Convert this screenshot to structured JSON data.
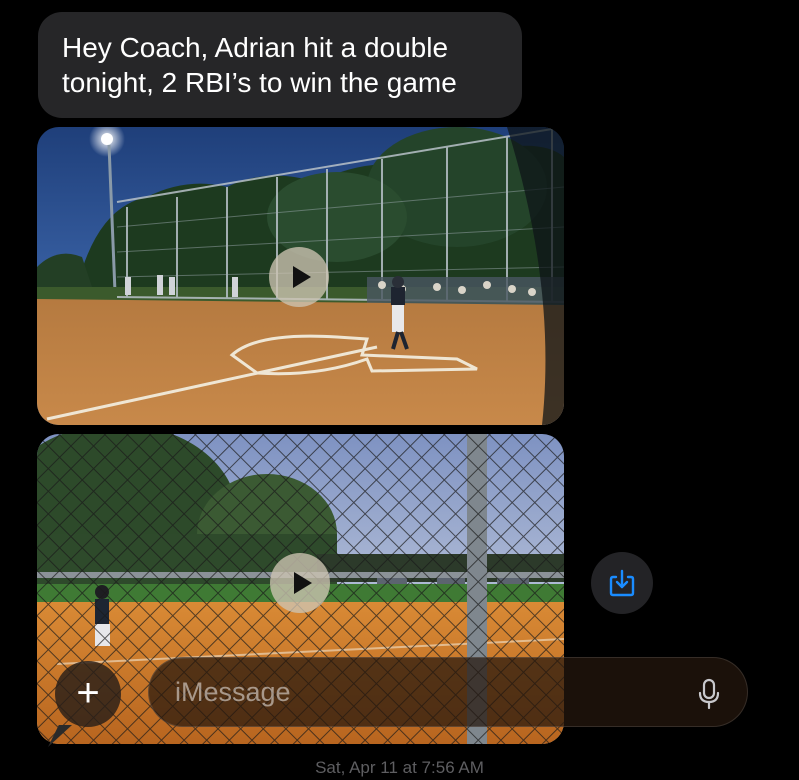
{
  "message": {
    "lines": [
      "Hey Coach, Adrian hit a double",
      "tonight, 2 RBI’s to win the game"
    ],
    "bubble_color": "#262628",
    "text_color": "#ffffff"
  },
  "attachments": [
    {
      "type": "video",
      "icon": "play-icon"
    },
    {
      "type": "video",
      "icon": "play-icon"
    }
  ],
  "save_button": {
    "icon": "save-to-photos-icon",
    "color": "#1a8cff"
  },
  "compose": {
    "plus_icon": "plus-icon",
    "plus_label": "+",
    "placeholder": "iMessage",
    "mic_icon": "microphone-icon"
  },
  "timestamp": {
    "day": "Sat, Apr 11",
    "time": "at 7:56 AM"
  }
}
